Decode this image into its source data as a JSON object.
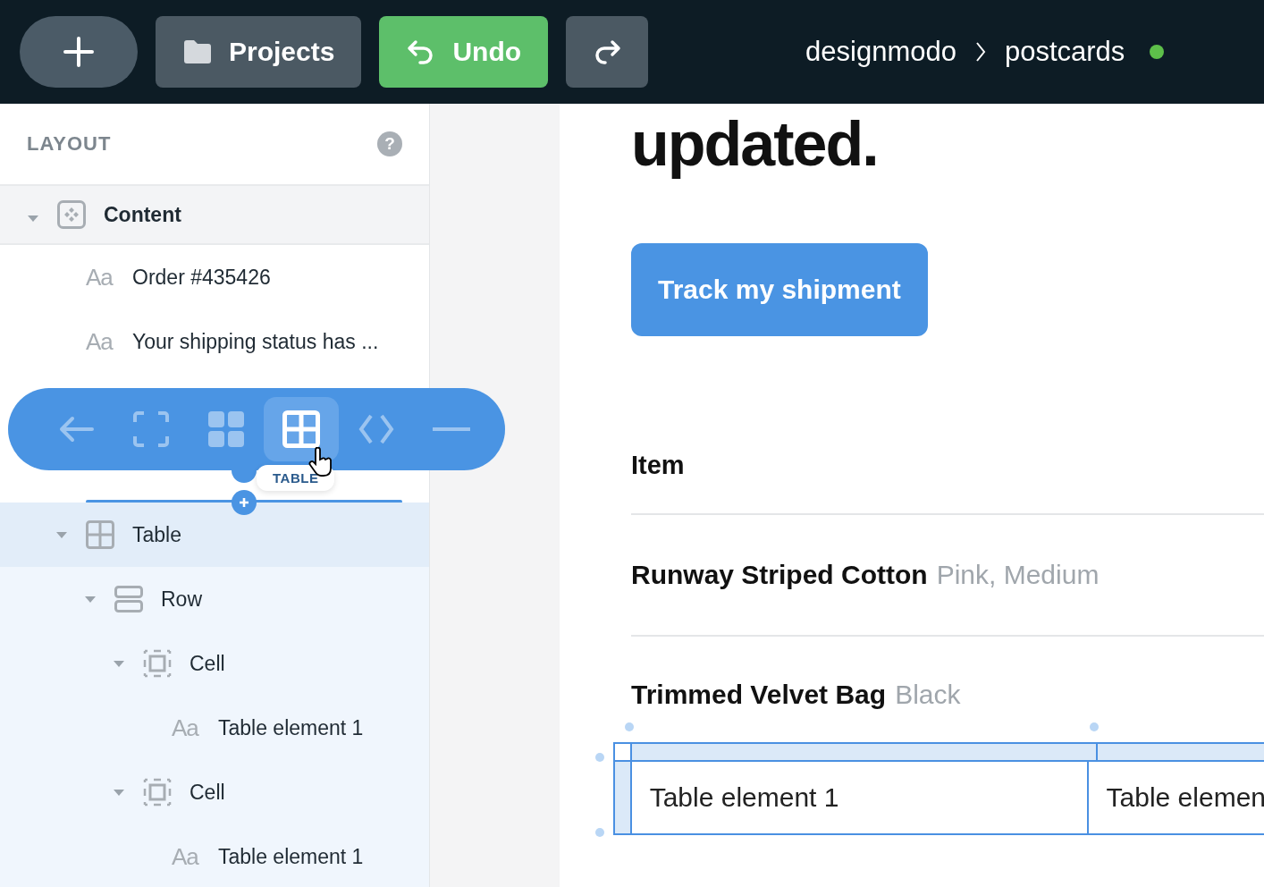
{
  "topbar": {
    "buttons": [
      {
        "kind": "add"
      },
      {
        "kind": "projects",
        "label": "Projects"
      },
      {
        "kind": "undo",
        "label": "Undo"
      },
      {
        "kind": "redo"
      }
    ],
    "breadcrumb": [
      "designmodo",
      "postcards"
    ],
    "online": true
  },
  "sidebar": {
    "title": "LAYOUT",
    "help": "?",
    "tree": [
      {
        "kind": "content",
        "label": "Content",
        "expanded": true,
        "selected": false,
        "children": [
          {
            "kind": "text",
            "icon": "Aa",
            "label": "Order #435426",
            "selected": false
          },
          {
            "kind": "text",
            "icon": "Aa",
            "label": "Your shipping status has ...",
            "selected": false
          },
          {
            "kind": "table",
            "label": "Table",
            "expanded": true,
            "selected": true,
            "children": [
              {
                "kind": "row",
                "label": "Row",
                "expanded": true,
                "selected": false,
                "children": [
                  {
                    "kind": "cell",
                    "label": "Cell",
                    "expanded": true,
                    "selected": false,
                    "children": [
                      {
                        "kind": "text",
                        "icon": "Aa",
                        "label": "Table element 1",
                        "selected": false
                      }
                    ]
                  },
                  {
                    "kind": "cell",
                    "label": "Cell",
                    "expanded": true,
                    "selected": false,
                    "children": [
                      {
                        "kind": "text",
                        "icon": "Aa",
                        "label": "Table element 1",
                        "selected": false
                      }
                    ]
                  }
                ]
              }
            ]
          }
        ]
      }
    ]
  },
  "toolbar": {
    "items": [
      {
        "kind": "back",
        "selected": false
      },
      {
        "kind": "frame",
        "selected": false
      },
      {
        "kind": "grid",
        "selected": false
      },
      {
        "kind": "table",
        "selected": true
      },
      {
        "kind": "code",
        "selected": false
      },
      {
        "kind": "divider",
        "selected": false
      }
    ],
    "tooltip": "TABLE"
  },
  "canvas": {
    "heading": "updated.",
    "button": "Track my shipment",
    "column_header": "Item",
    "products": [
      {
        "name": "Runway Striped Cotton",
        "variant": "Pink, Medium"
      },
      {
        "name": "Trimmed Velvet Bag",
        "variant": "Black"
      }
    ],
    "table_cells": [
      "Table element 1",
      "Table elemen"
    ]
  }
}
